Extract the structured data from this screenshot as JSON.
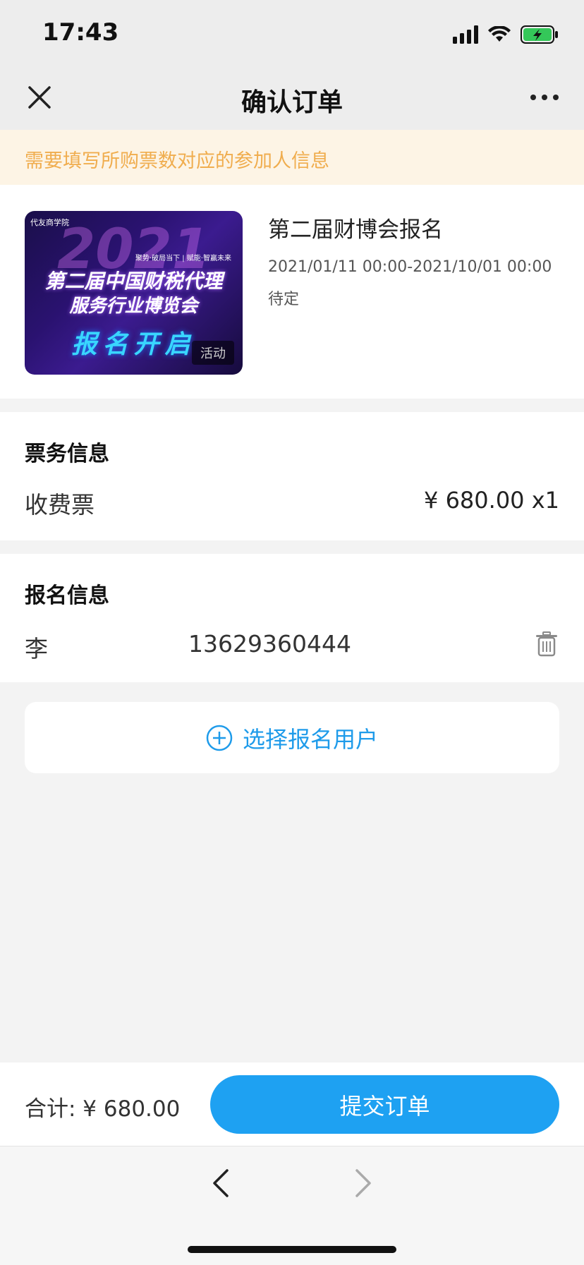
{
  "status_bar": {
    "time": "17:43",
    "icons": [
      "signal-icon",
      "wifi-icon",
      "battery-charging-icon"
    ]
  },
  "nav": {
    "title": "确认订单",
    "close_icon": "close-icon",
    "more_icon": "more-icon"
  },
  "notice": {
    "text": "需要填写所购票数对应的参加人信息"
  },
  "event": {
    "title": "第二届财博会报名",
    "time_range": "2021/01/11 00:00-2021/10/01 00:00",
    "location": "待定",
    "poster": {
      "logo": "代友商学院",
      "slogan": "聚势·破局当下 | 赋能·智赢未来",
      "year": "2021",
      "headline_1": "第二届中国财税代理",
      "headline_2": "服务行业博览会",
      "headline_3": "报名开启",
      "tag": "活动"
    }
  },
  "ticket": {
    "section_title": "票务信息",
    "type": "收费票",
    "price": "¥ 680.00 x1"
  },
  "registration": {
    "section_title": "报名信息",
    "name": "李",
    "phone": "13629360444"
  },
  "select_user": {
    "label": "选择报名用户"
  },
  "bottom": {
    "total": "合计: ¥ 680.00",
    "submit": "提交订单"
  },
  "colors": {
    "accent": "#1ea1f2",
    "notice_text": "#f0ad4e",
    "notice_bg": "#fdf4e5"
  }
}
